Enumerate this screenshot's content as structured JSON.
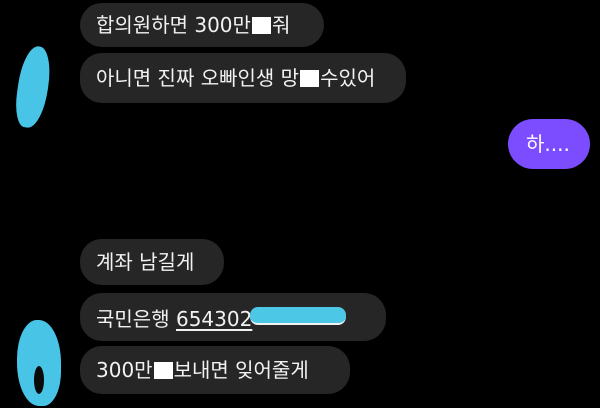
{
  "conversation": {
    "messages": [
      {
        "sender": "them",
        "parts": [
          "합의원하면 300만",
          "[redacted]",
          "줘"
        ]
      },
      {
        "sender": "them",
        "parts": [
          "아니면 진짜 오빠인생 망",
          "[redacted]",
          "수있어"
        ]
      },
      {
        "sender": "me",
        "text": "하...."
      },
      {
        "sender": "them",
        "text": "계좌 남길게"
      },
      {
        "sender": "them",
        "bank": "국민은행",
        "account_visible": "654302",
        "account_rest": "[redacted]"
      },
      {
        "sender": "them",
        "parts": [
          "300만",
          "[redacted]",
          "보내면 잊어줄게"
        ]
      }
    ]
  },
  "avatars": [
    {
      "name": "sender-avatar-top",
      "state": "redacted"
    },
    {
      "name": "sender-avatar-bottom",
      "state": "redacted"
    }
  ],
  "colors": {
    "background": "#000000",
    "received_bubble": "#262626",
    "sent_bubble": "#7b4dff",
    "redaction_mark": "#48c4e6",
    "text": "#f2f2f2"
  }
}
